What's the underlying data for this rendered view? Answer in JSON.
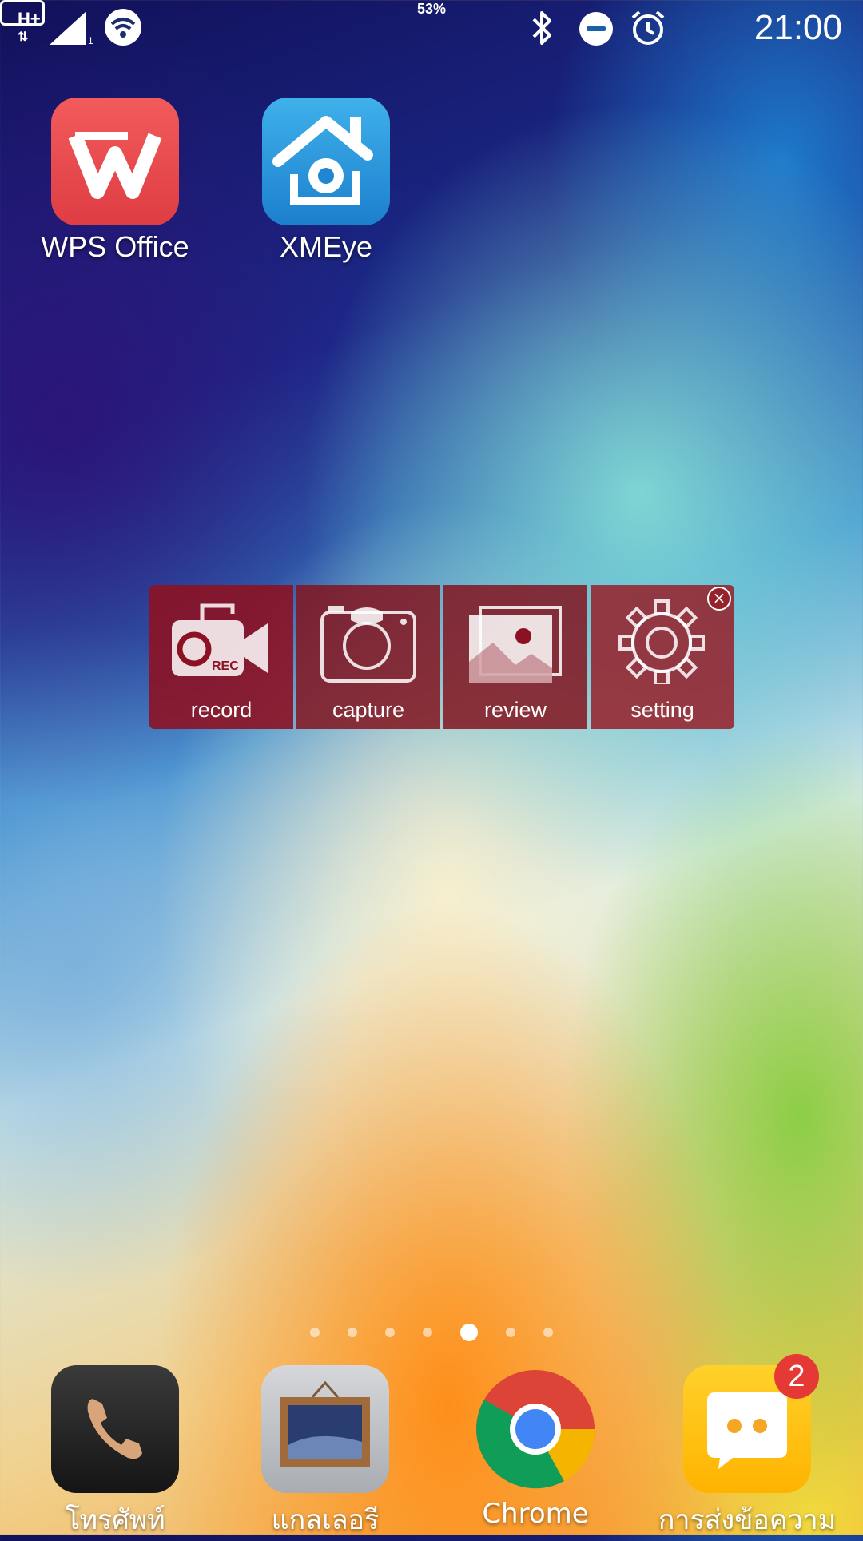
{
  "status_bar": {
    "network_type": "H+",
    "sim_indicator": "1",
    "battery_level": "53%",
    "time": "21:00",
    "icons": [
      "signal-icon",
      "wifi-icon",
      "bluetooth-icon",
      "do-not-disturb-icon",
      "alarm-icon",
      "battery-icon"
    ]
  },
  "home_apps": [
    {
      "label": "WPS Office",
      "icon": "wps-office-icon"
    },
    {
      "label": "XMEye",
      "icon": "xmeye-icon"
    }
  ],
  "recorder_widget": {
    "items": [
      {
        "label": "record",
        "icon": "video-record-icon"
      },
      {
        "label": "capture",
        "icon": "camera-icon"
      },
      {
        "label": "review",
        "icon": "gallery-image-icon"
      },
      {
        "label": "setting",
        "icon": "gear-icon"
      }
    ],
    "close_icon": "close-icon",
    "color": "#8c1223"
  },
  "page_indicator": {
    "total": 7,
    "active_index": 5
  },
  "dock": [
    {
      "label": "โทรศัพท์",
      "icon": "phone-icon"
    },
    {
      "label": "แกลเลอรี",
      "icon": "gallery-icon"
    },
    {
      "label": "Chrome",
      "icon": "chrome-icon"
    },
    {
      "label": "การส่งข้อความ",
      "icon": "messaging-icon",
      "badge": "2"
    }
  ]
}
